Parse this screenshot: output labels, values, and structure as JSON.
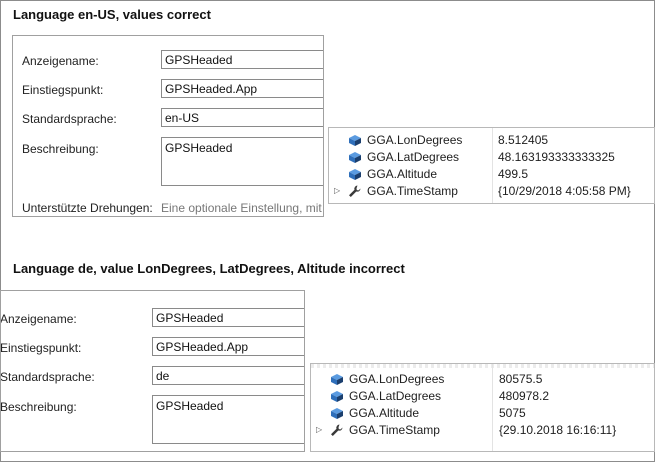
{
  "section1": {
    "heading": "Language en-US, values correct",
    "form": {
      "display_name_label": "Anzeigename:",
      "display_name_value": "GPSHeaded",
      "entry_point_label": "Einstiegspunkt:",
      "entry_point_value": "GPSHeaded.App",
      "default_language_label": "Standardsprache:",
      "default_language_value": "en-US",
      "description_label": "Beschreibung:",
      "description_value": "GPSHeaded",
      "rotations_label": "Unterstützte Drehungen:",
      "rotations_hint": "Eine optionale Einstellung, mit"
    },
    "properties": [
      {
        "name": "GGA.LonDegrees",
        "value": "8.512405",
        "icon": "property-icon",
        "expandable": false
      },
      {
        "name": "GGA.LatDegrees",
        "value": "48.163193333333325",
        "icon": "property-icon",
        "expandable": false
      },
      {
        "name": "GGA.Altitude",
        "value": "499.5",
        "icon": "property-icon",
        "expandable": false
      },
      {
        "name": "GGA.TimeStamp",
        "value": "{10/29/2018 4:05:58 PM}",
        "icon": "wrench-icon",
        "expandable": true
      }
    ]
  },
  "section2": {
    "heading": "Language de, value LonDegrees, LatDegrees, Altitude incorrect",
    "form": {
      "display_name_label": "Anzeigename:",
      "display_name_value": "GPSHeaded",
      "entry_point_label": "Einstiegspunkt:",
      "entry_point_value": "GPSHeaded.App",
      "default_language_label": "Standardsprache:",
      "default_language_value": "de",
      "description_label": "Beschreibung:",
      "description_value": "GPSHeaded"
    },
    "properties": [
      {
        "name": "GGA.LonDegrees",
        "value": "80575.5",
        "icon": "property-icon",
        "expandable": false
      },
      {
        "name": "GGA.LatDegrees",
        "value": "480978.2",
        "icon": "property-icon",
        "expandable": false
      },
      {
        "name": "GGA.Altitude",
        "value": "5075",
        "icon": "property-icon",
        "expandable": false
      },
      {
        "name": "GGA.TimeStamp",
        "value": "{29.10.2018 16:16:11}",
        "icon": "wrench-icon",
        "expandable": true
      }
    ]
  },
  "colors": {
    "property_icon": "#2f6fba",
    "property_icon_accent": "#1b3f6e",
    "wrench_icon": "#3a3a3a"
  }
}
